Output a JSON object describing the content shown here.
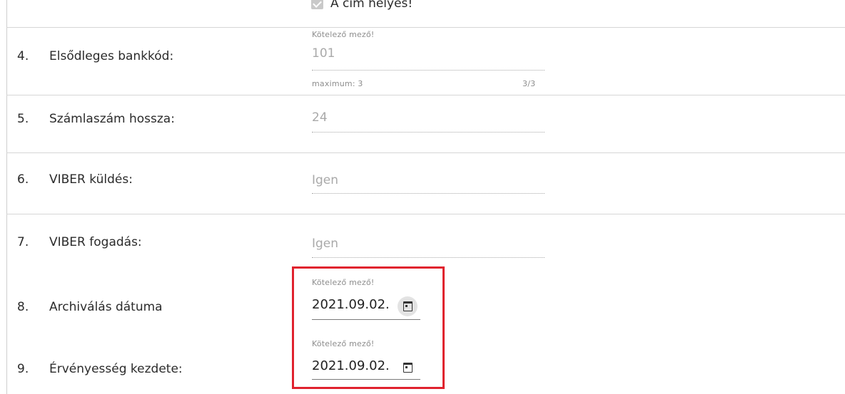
{
  "top_checkbox": {
    "label": "A cím helyes!",
    "checked": true
  },
  "rows": [
    {
      "number": "4.",
      "label": "Elsődleges bankkód:",
      "required_hint": "Kötelező mező!",
      "value": "101",
      "max_label": "maximum: 3",
      "char_count": "3/3"
    },
    {
      "number": "5.",
      "label": "Számlaszám hossza:",
      "value": "24"
    },
    {
      "number": "6.",
      "label": "VIBER küldés:",
      "value": "Igen"
    },
    {
      "number": "7.",
      "label": "VIBER fogadás:",
      "value": "Igen"
    },
    {
      "number": "8.",
      "label": "Archiválás dátuma",
      "required_hint": "Kötelező mező!",
      "value": "2021.09.02."
    },
    {
      "number": "9.",
      "label": "Érvényesség kezdete:",
      "required_hint": "Kötelező mező!",
      "value": "2021.09.02."
    }
  ],
  "icons": {
    "date_picker": "calendar-icon",
    "checkbox": "checkmark-icon"
  },
  "colors": {
    "highlight": "#e0222e",
    "readonly_text": "#a9a9a9",
    "hint_text": "#8d8d8d"
  }
}
